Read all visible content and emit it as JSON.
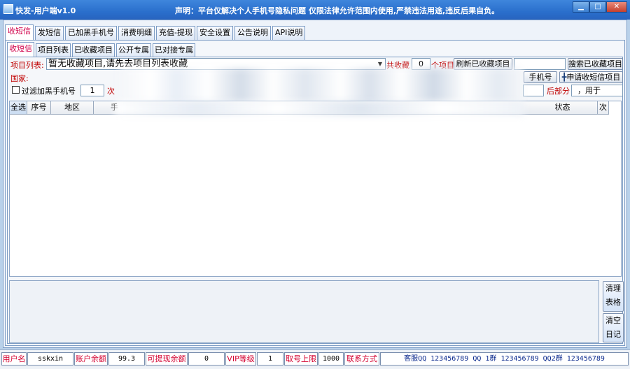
{
  "window": {
    "title": "快发-用户端v1.0",
    "notice": "声明：平台仅解决个人手机号隐私问题 仅限法律允许范围内使用,严禁违法用途,违反后果自负。",
    "min_glyph": "▁",
    "max_glyph": "□",
    "close_glyph": "✕"
  },
  "main_tabs": [
    "收短信",
    "发短信",
    "已加黑手机号",
    "消费明细",
    "充值-提现",
    "安全设置",
    "公告说明",
    "API说明"
  ],
  "sub_tabs": [
    "收短信",
    "项目列表",
    "已收藏项目",
    "公开专属",
    "已对接专属"
  ],
  "toolbar": {
    "project_label": "项目列表:",
    "project_select": "暂无收藏项目,请先去项目列表收藏",
    "total_label": "共收藏",
    "total_value": "0",
    "unit_label": "个项目",
    "refresh_button": "刷新已收藏项目",
    "search_value": "",
    "search_button": "搜索已收藏项目",
    "country_label": "国家:",
    "phone_button_partial": "手机号",
    "apply_button": "申请收短信项目",
    "filter_label": "过滤加黑手机号",
    "filter_value": "1",
    "next_partial": "次",
    "rear_label": "后部分",
    "for_label": "，用于"
  },
  "table": {
    "columns": [
      "全选",
      "序号",
      "地区",
      "手",
      "状态",
      "次"
    ]
  },
  "side_buttons": {
    "clear_table": [
      "清理",
      "表格"
    ],
    "clear_log": [
      "清空",
      "日记"
    ]
  },
  "status": {
    "username_label": "用户名",
    "username": "sskxin",
    "balance_label": "账户余额",
    "balance": "99.3",
    "withdraw_label": "可提现余额",
    "withdraw": "0",
    "vip_label": "VIP等级",
    "vip": "1",
    "limit_label": "取号上限",
    "limit": "1000",
    "contact_label": "联系方式",
    "contact": "客服QQ 123456789 QQ 1群 123456789 QQ2群 123456789"
  }
}
